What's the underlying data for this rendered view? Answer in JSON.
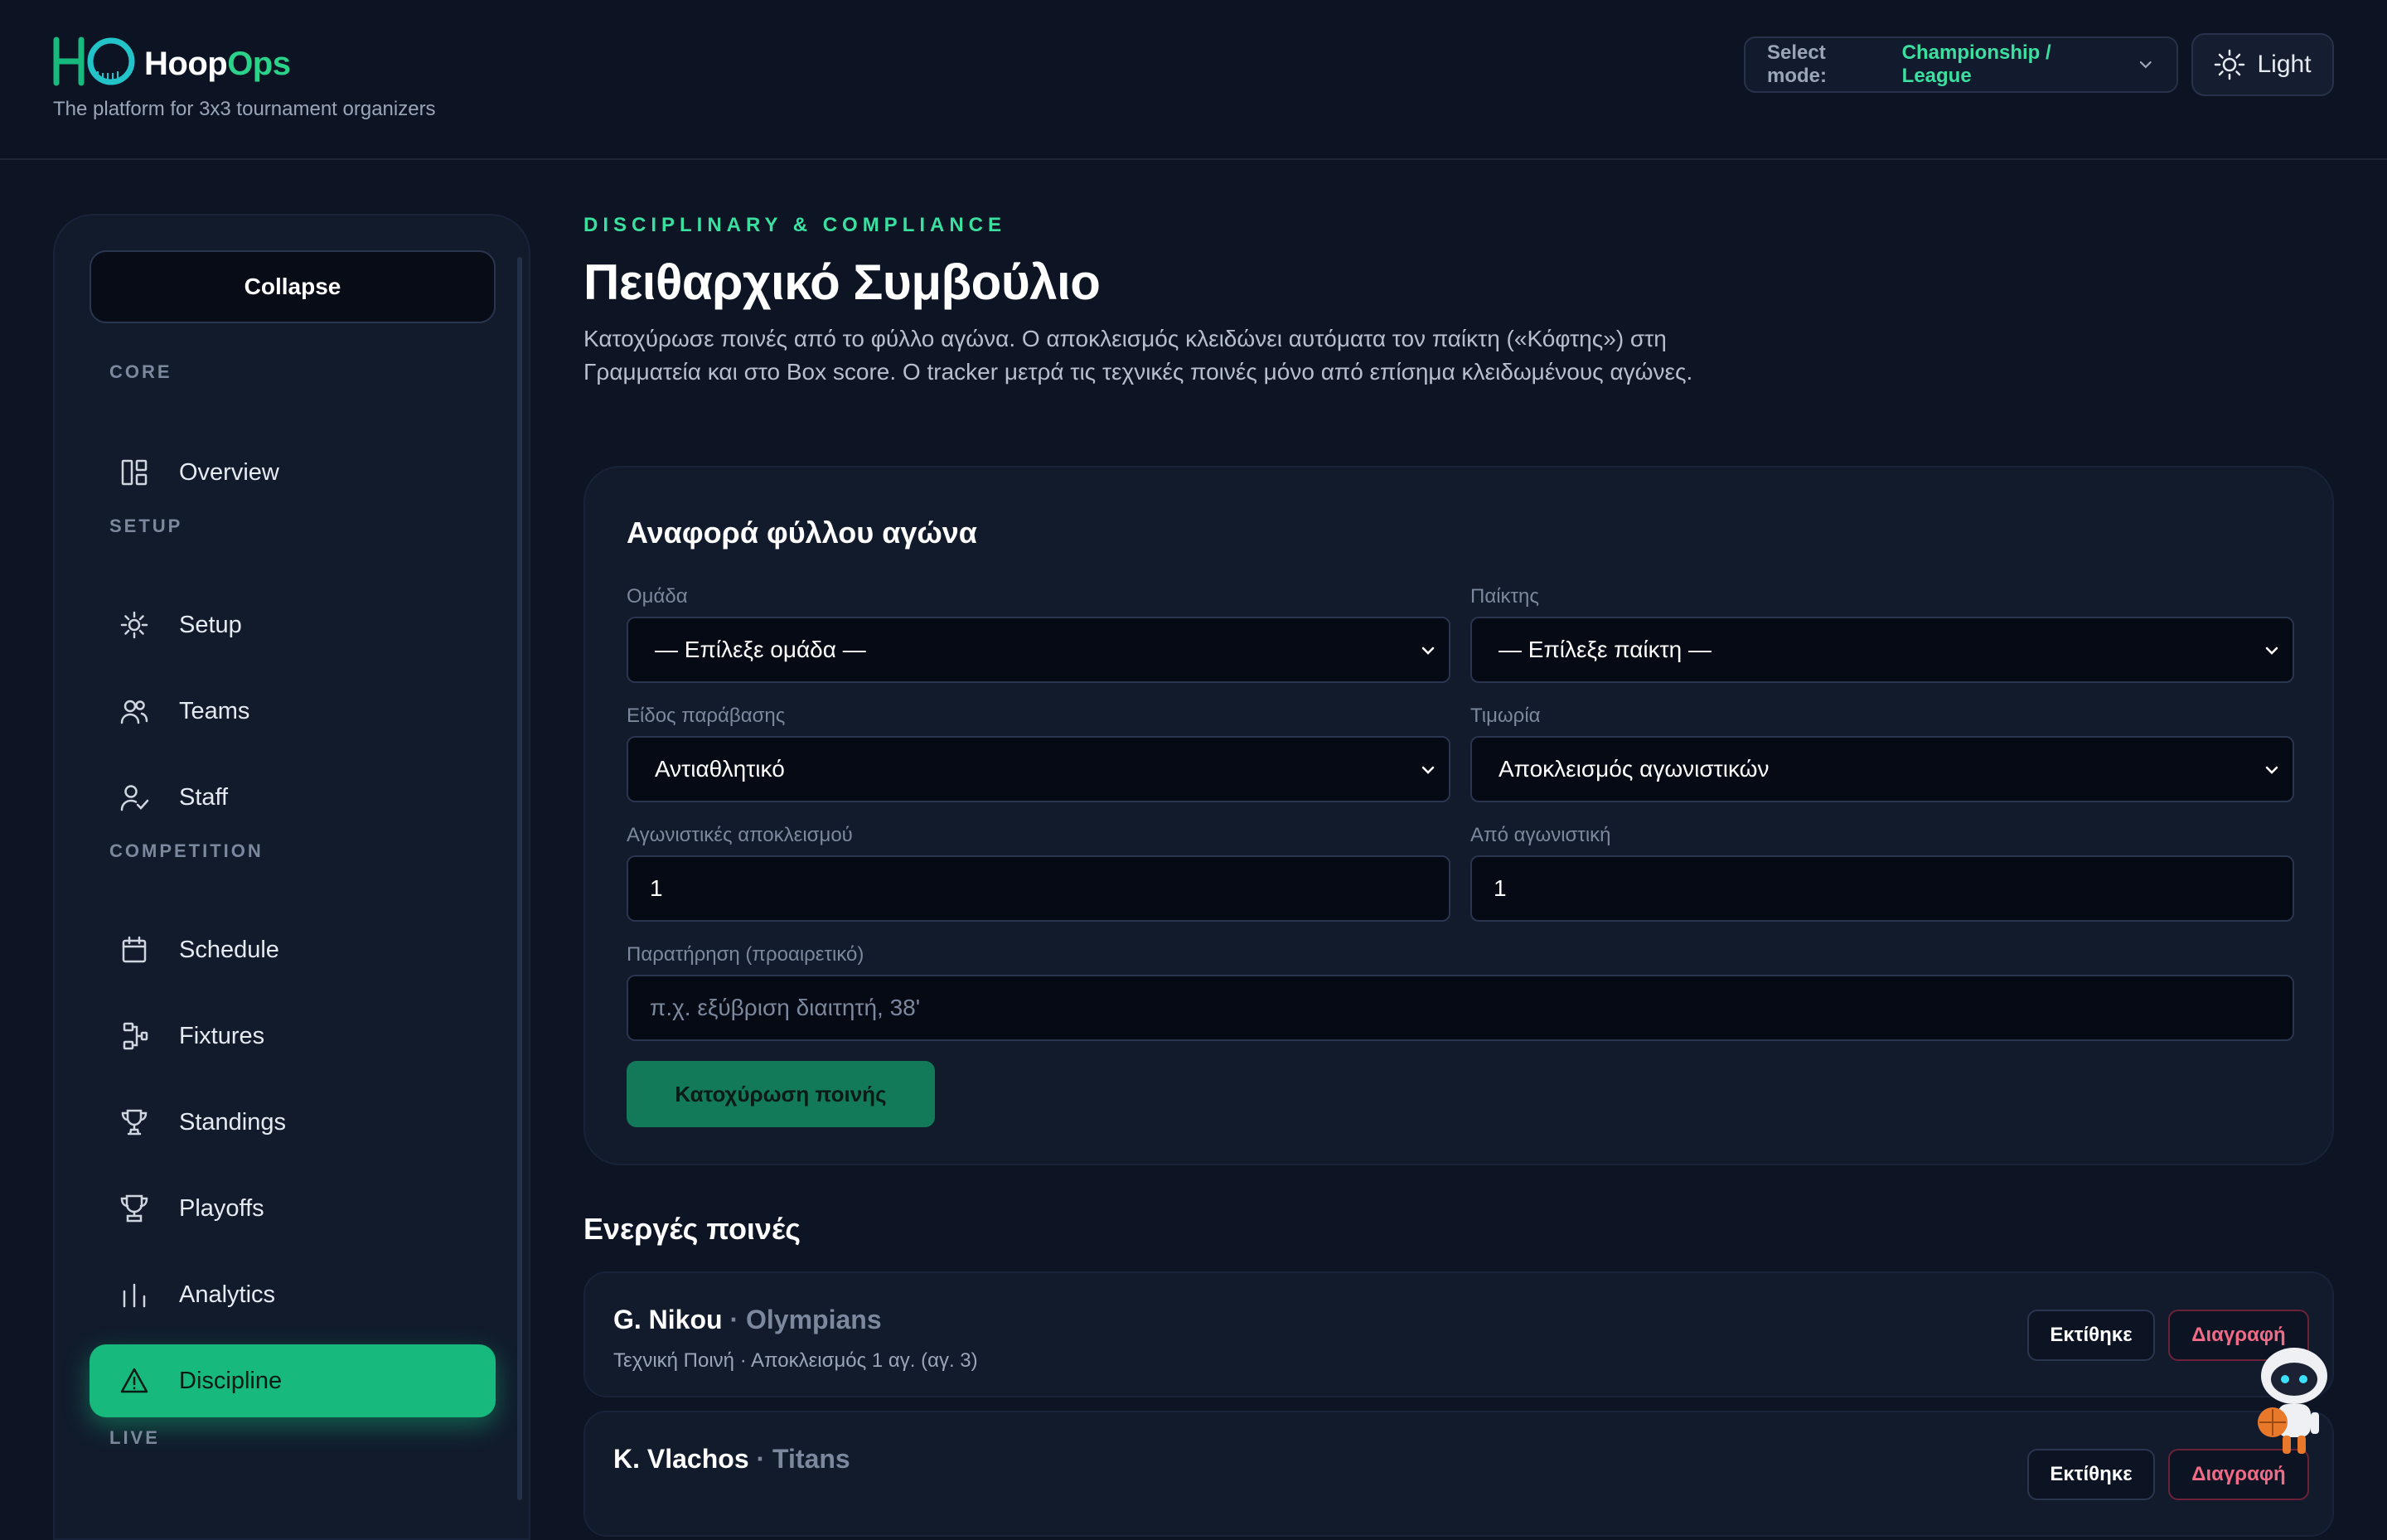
{
  "brand": {
    "name_part1": "Hoop",
    "name_part2": "Ops",
    "tagline": "The platform for 3x3 tournament organizers",
    "accent_color": "#2bd38a"
  },
  "header": {
    "mode_label": "Select mode:",
    "mode_value": "Championship / League",
    "theme_label": "Light"
  },
  "sidebar": {
    "collapse_label": "Collapse",
    "sections": {
      "core": "CORE",
      "setup": "SETUP",
      "competition": "COMPETITION",
      "live": "LIVE"
    },
    "items": {
      "overview": "Overview",
      "setup": "Setup",
      "teams": "Teams",
      "staff": "Staff",
      "schedule": "Schedule",
      "fixtures": "Fixtures",
      "standings": "Standings",
      "playoffs": "Playoffs",
      "analytics": "Analytics",
      "discipline": "Discipline"
    },
    "active_item": "discipline",
    "active_color": "#17b97c"
  },
  "page": {
    "eyebrow": "DISCIPLINARY & COMPLIANCE",
    "title": "Πειθαρχικό Συμβούλιο",
    "description": "Κατοχύρωσε ποινές από το φύλλο αγώνα. Ο αποκλεισμός κλειδώνει αυτόματα τον παίκτη («Κόφτης») στη Γραμματεία και στο Box score. Ο tracker μετρά τις τεχνικές ποινές μόνο από επίσημα κλειδωμένους αγώνες."
  },
  "report_form": {
    "title": "Αναφορά φύλλου αγώνα",
    "team_label": "Ομάδα",
    "team_value": "— Επίλεξε ομάδα —",
    "player_label": "Παίκτης",
    "player_value": "— Επίλεξε παίκτη —",
    "offense_label": "Είδος παράβασης",
    "offense_value": "Αντιαθλητικό",
    "penalty_label": "Τιμωρία",
    "penalty_value": "Αποκλεισμός αγωνιστικών",
    "ban_rounds_label": "Αγωνιστικές αποκλεισμού",
    "ban_rounds_value": "1",
    "from_round_label": "Από αγωνιστική",
    "from_round_value": "1",
    "note_label": "Παρατήρηση (προαιρετικό)",
    "note_placeholder": "π.χ. εξύβριση διαιτητή, 38'",
    "submit_label": "Κατοχύρωση ποινής"
  },
  "active_penalties": {
    "title": "Ενεργές ποινές",
    "served_label": "Εκτίθηκε",
    "delete_label": "Διαγραφή",
    "items": [
      {
        "player": "G. Nikou",
        "team": "· Olympians",
        "detail": "Τεχνική Ποινή · Αποκλεισμός 1 αγ. (αγ. 3)"
      },
      {
        "player": "K. Vlachos",
        "team": "· Titans",
        "detail": ""
      }
    ]
  }
}
